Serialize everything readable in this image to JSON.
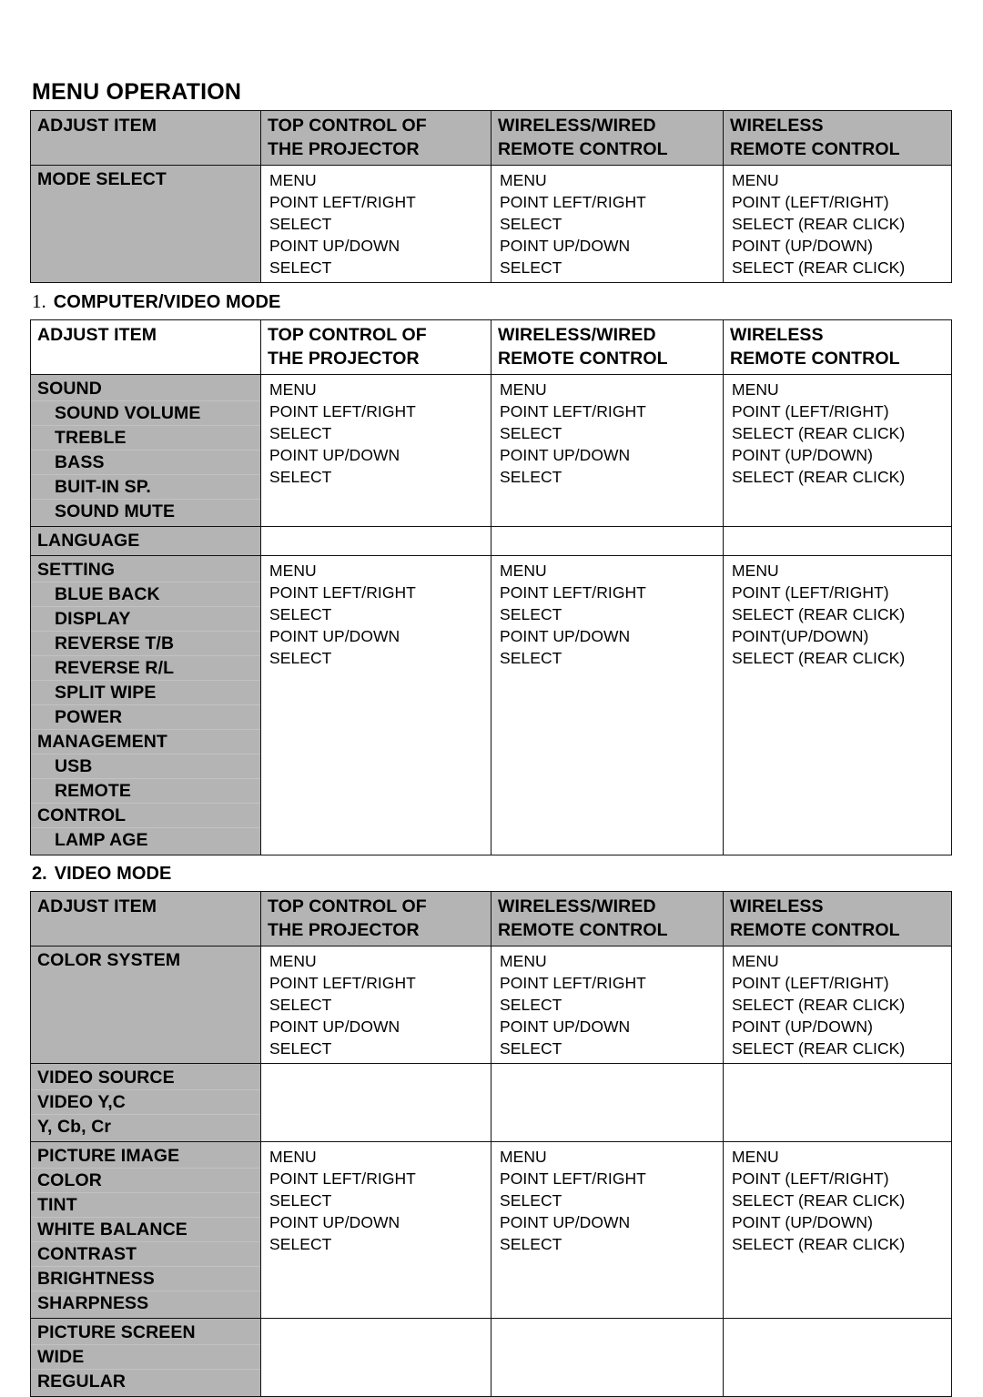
{
  "document": {
    "title": "MENU OPERATION"
  },
  "colors": {
    "header_gray": "#b4b4b4",
    "item_gray": "#b4b4b4",
    "border": "#111111",
    "sub_separator": "#c2c2c2",
    "page_background": "#ffffff",
    "text": "#000000"
  },
  "columns": [
    "ADJUST ITEM",
    "TOP CONTROL OF\nTHE PROJECTOR",
    "WIRELESS/WIRED\nREMOTE CONTROL",
    "WIRELESS\nREMOTE CONTROL"
  ],
  "step_sets": {
    "standard_top_control": [
      "MENU",
      "POINT LEFT/RIGHT",
      "SELECT",
      "POINT UP/DOWN",
      "SELECT"
    ],
    "standard_wireless_wired": [
      "MENU",
      "POINT LEFT/RIGHT",
      "SELECT",
      "POINT UP/DOWN",
      "SELECT"
    ],
    "standard_wireless": [
      "MENU",
      "POINT (LEFT/RIGHT)",
      "SELECT (REAR CLICK)",
      "POINT (UP/DOWN)",
      "SELECT (REAR CLICK)"
    ],
    "setting_wireless": [
      "MENU",
      "POINT (LEFT/RIGHT)",
      "SELECT (REAR CLICK)",
      "POINT(UP/DOWN)",
      "SELECT (REAR CLICK)"
    ]
  },
  "tables": [
    {
      "id": "mode-select-table",
      "heading": null,
      "header_background": "gray",
      "groups": [
        {
          "items": [
            {
              "label": "MODE SELECT",
              "indent": false
            }
          ],
          "min_height": 100,
          "steps": [
            "standard_top_control",
            "standard_wireless_wired",
            "standard_wireless"
          ]
        }
      ]
    },
    {
      "id": "computer-video-mode-table",
      "heading": {
        "number": "1.",
        "number_style": "serif",
        "label": "COMPUTER/VIDEO MODE"
      },
      "header_background": "white",
      "groups": [
        {
          "items": [
            {
              "label": "SOUND",
              "indent": false
            },
            {
              "label": "SOUND VOLUME",
              "indent": true
            },
            {
              "label": "TREBLE",
              "indent": true
            },
            {
              "label": "BASS",
              "indent": true
            },
            {
              "label": "BUIT-IN SP.",
              "indent": true
            },
            {
              "label": "SOUND MUTE",
              "indent": true
            }
          ],
          "min_height": 0,
          "steps": [
            "standard_top_control",
            "standard_wireless_wired",
            "standard_wireless"
          ]
        },
        {
          "items": [
            {
              "label": "LANGUAGE",
              "indent": false
            }
          ],
          "min_height": 0,
          "steps": [
            null,
            null,
            null
          ]
        },
        {
          "items": [
            {
              "label": "SETTING",
              "indent": false
            },
            {
              "label": "BLUE BACK",
              "indent": true
            },
            {
              "label": "DISPLAY",
              "indent": true
            },
            {
              "label": "REVERSE T/B",
              "indent": true
            },
            {
              "label": "REVERSE R/L",
              "indent": true
            },
            {
              "label": "SPLIT WIPE",
              "indent": true
            },
            {
              "label": "POWER",
              "indent": true
            },
            {
              "label": "MANAGEMENT",
              "indent": false
            },
            {
              "label": "USB",
              "indent": true
            },
            {
              "label": "REMOTE",
              "indent": true
            },
            {
              "label": "CONTROL",
              "indent": false
            },
            {
              "label": "LAMP AGE",
              "indent": true
            }
          ],
          "min_height": 0,
          "steps": [
            "standard_top_control",
            "standard_wireless_wired",
            "setting_wireless"
          ]
        }
      ]
    },
    {
      "id": "video-mode-table",
      "heading": {
        "number": "2.",
        "number_style": "bold",
        "label": "VIDEO MODE"
      },
      "header_background": "gray",
      "groups": [
        {
          "items": [
            {
              "label": "COLOR SYSTEM",
              "indent": false
            }
          ],
          "min_height": 0,
          "steps": [
            "standard_top_control",
            "standard_wireless_wired",
            "standard_wireless"
          ]
        },
        {
          "items": [
            {
              "label": "VIDEO SOURCE",
              "indent": false
            },
            {
              "label": "VIDEO Y,C",
              "indent": false
            },
            {
              "label": "Y, Cb, Cr",
              "indent": false
            }
          ],
          "min_height": 0,
          "steps": [
            null,
            null,
            null
          ]
        },
        {
          "items": [
            {
              "label": "PICTURE IMAGE",
              "indent": false
            },
            {
              "label": "COLOR",
              "indent": false
            },
            {
              "label": "TINT",
              "indent": false
            },
            {
              "label": "WHITE BALANCE",
              "indent": false
            },
            {
              "label": "CONTRAST",
              "indent": false
            },
            {
              "label": "BRIGHTNESS",
              "indent": false
            },
            {
              "label": "SHARPNESS",
              "indent": false
            }
          ],
          "min_height": 0,
          "steps": [
            "standard_top_control",
            "standard_wireless_wired",
            "standard_wireless"
          ]
        },
        {
          "items": [
            {
              "label": "PICTURE SCREEN",
              "indent": false
            },
            {
              "label": "WIDE",
              "indent": false
            },
            {
              "label": "REGULAR",
              "indent": false
            }
          ],
          "min_height": 0,
          "steps": [
            null,
            null,
            null
          ]
        }
      ]
    }
  ]
}
